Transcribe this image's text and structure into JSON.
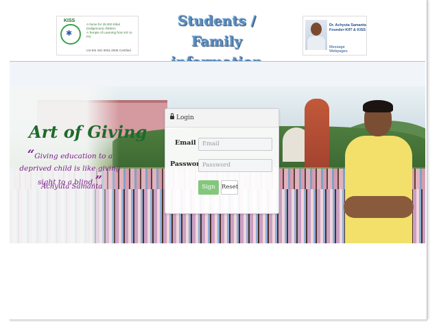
{
  "header": {
    "kiss_logo": {
      "title": "KISS",
      "lines": [
        "A home for 25,000 tribal",
        "(indigenous) children",
        "A Temple of Learning from KG to PG"
      ],
      "footer": "US-EN ISO 9001:2008 Certified"
    },
    "title_line1": "Students / Family",
    "title_line2": "information sheet",
    "founder": {
      "name_line1": "Dr. Achyuta Samanta",
      "name_line2": "Founder-KIIT & KISS",
      "links": [
        "Message",
        "Webpages"
      ]
    }
  },
  "banner": {
    "heading": "Art of Giving",
    "quote_open": "“",
    "quote_text": "Giving education to a deprived child is like giving sight to a blind.",
    "quote_close": "”",
    "author": "Achyuta Samanta"
  },
  "login": {
    "header": "Login",
    "email_label": "Email",
    "email_placeholder": "Email",
    "password_label": "Password",
    "password_placeholder": "Password",
    "signin_label": "Sign In",
    "reset_label": "Reset",
    "signin_color": "#83c77d"
  }
}
